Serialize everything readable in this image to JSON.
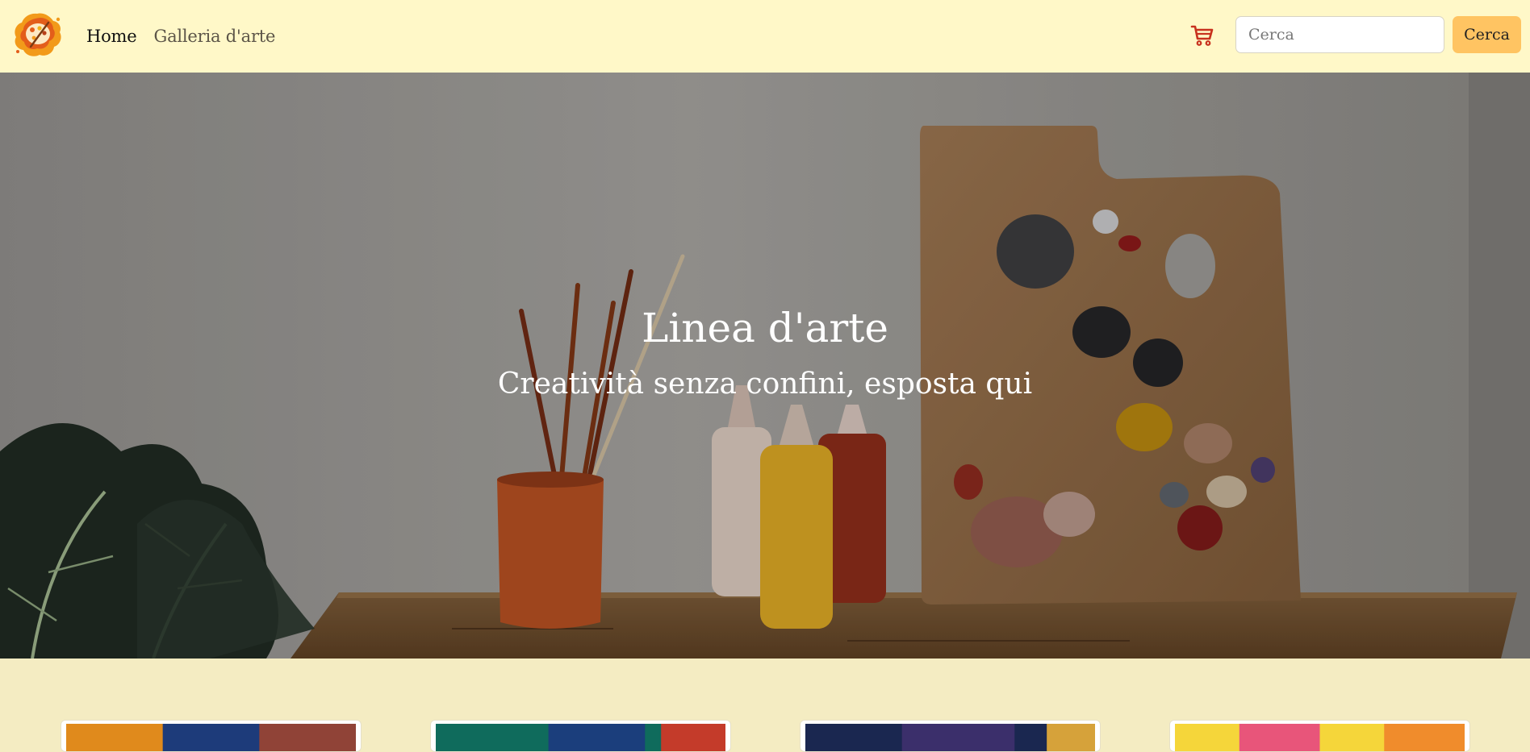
{
  "navbar": {
    "logo_icon": "palette-splash-logo",
    "links": [
      {
        "label": "Home",
        "active": true
      },
      {
        "label": "Galleria d'arte",
        "active": false
      }
    ],
    "cart_icon": "cart-icon",
    "search": {
      "placeholder": "Cerca",
      "value": "",
      "button_label": "Cerca"
    }
  },
  "hero": {
    "title": "Linea d'arte",
    "subtitle": "Creatività senza confini, esposta qui"
  },
  "cards": [
    {
      "thumb_colors": [
        "#1d3b7a",
        "#e08a1c",
        "#c2471b"
      ]
    },
    {
      "thumb_colors": [
        "#0f6b5c",
        "#1b3e7c",
        "#c43b2a"
      ]
    },
    {
      "thumb_colors": [
        "#1a2750",
        "#3b2f6b",
        "#d6a23a"
      ]
    },
    {
      "thumb_colors": [
        "#f5d63a",
        "#e8557a",
        "#f08c2c"
      ]
    }
  ],
  "colors": {
    "navbar_bg": "#fff8c8",
    "page_bg": "#f4ecc2",
    "accent": "#ffc462",
    "cart": "#c8321e"
  }
}
